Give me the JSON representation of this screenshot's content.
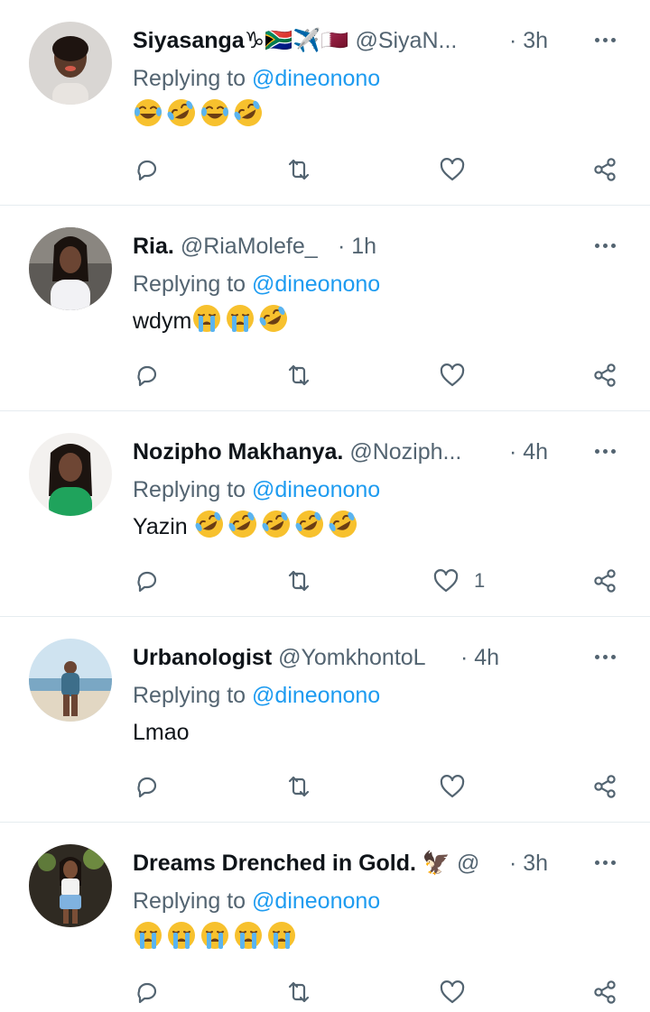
{
  "tweets": [
    {
      "name": "Siyasanga",
      "name_extra": "♑🇿🇦✈️🇶🇦",
      "handle": "@SiyaN...",
      "time": "· 3h",
      "replying_label": "Replying to",
      "mention": "@dineonono",
      "text": "",
      "emojis": [
        "joy",
        "rofl",
        "joy",
        "rofl"
      ],
      "like_count": ""
    },
    {
      "name": "Ria.",
      "name_extra": "",
      "handle": "@RiaMolefe_",
      "time": "· 1h",
      "replying_label": "Replying to",
      "mention": "@dineonono",
      "text": "wdym",
      "emojis": [
        "sob",
        "sob",
        "rofl"
      ],
      "like_count": ""
    },
    {
      "name": "Nozipho Makhanya.",
      "name_extra": "",
      "handle": "@Noziph...",
      "time": "· 4h",
      "replying_label": "Replying to",
      "mention": "@dineonono",
      "text": "Yazin",
      "emojis": [
        "rofl",
        "rofl",
        "rofl",
        "rofl",
        "rofl"
      ],
      "like_count": "1"
    },
    {
      "name": "Urbanologist",
      "name_extra": "",
      "handle": "@YomkhontoL",
      "time": "· 4h",
      "replying_label": "Replying to",
      "mention": "@dineonono",
      "text": "Lmao",
      "emojis": [],
      "like_count": ""
    },
    {
      "name": "Dreams Drenched in Gold.",
      "name_extra": "🦅",
      "handle": "@",
      "time": "· 3h",
      "replying_label": "Replying to",
      "mention": "@dineonono",
      "text": "",
      "emojis": [
        "sob",
        "sob",
        "sob",
        "sob",
        "sob"
      ],
      "like_count": ""
    }
  ],
  "icons": [
    "reply-icon",
    "retweet-icon",
    "like-icon",
    "share-icon",
    "more-icon"
  ],
  "colors": {
    "text": "#0f1419",
    "secondary": "#536471",
    "link": "#1d9bf0",
    "divider": "#e6ecf0"
  }
}
